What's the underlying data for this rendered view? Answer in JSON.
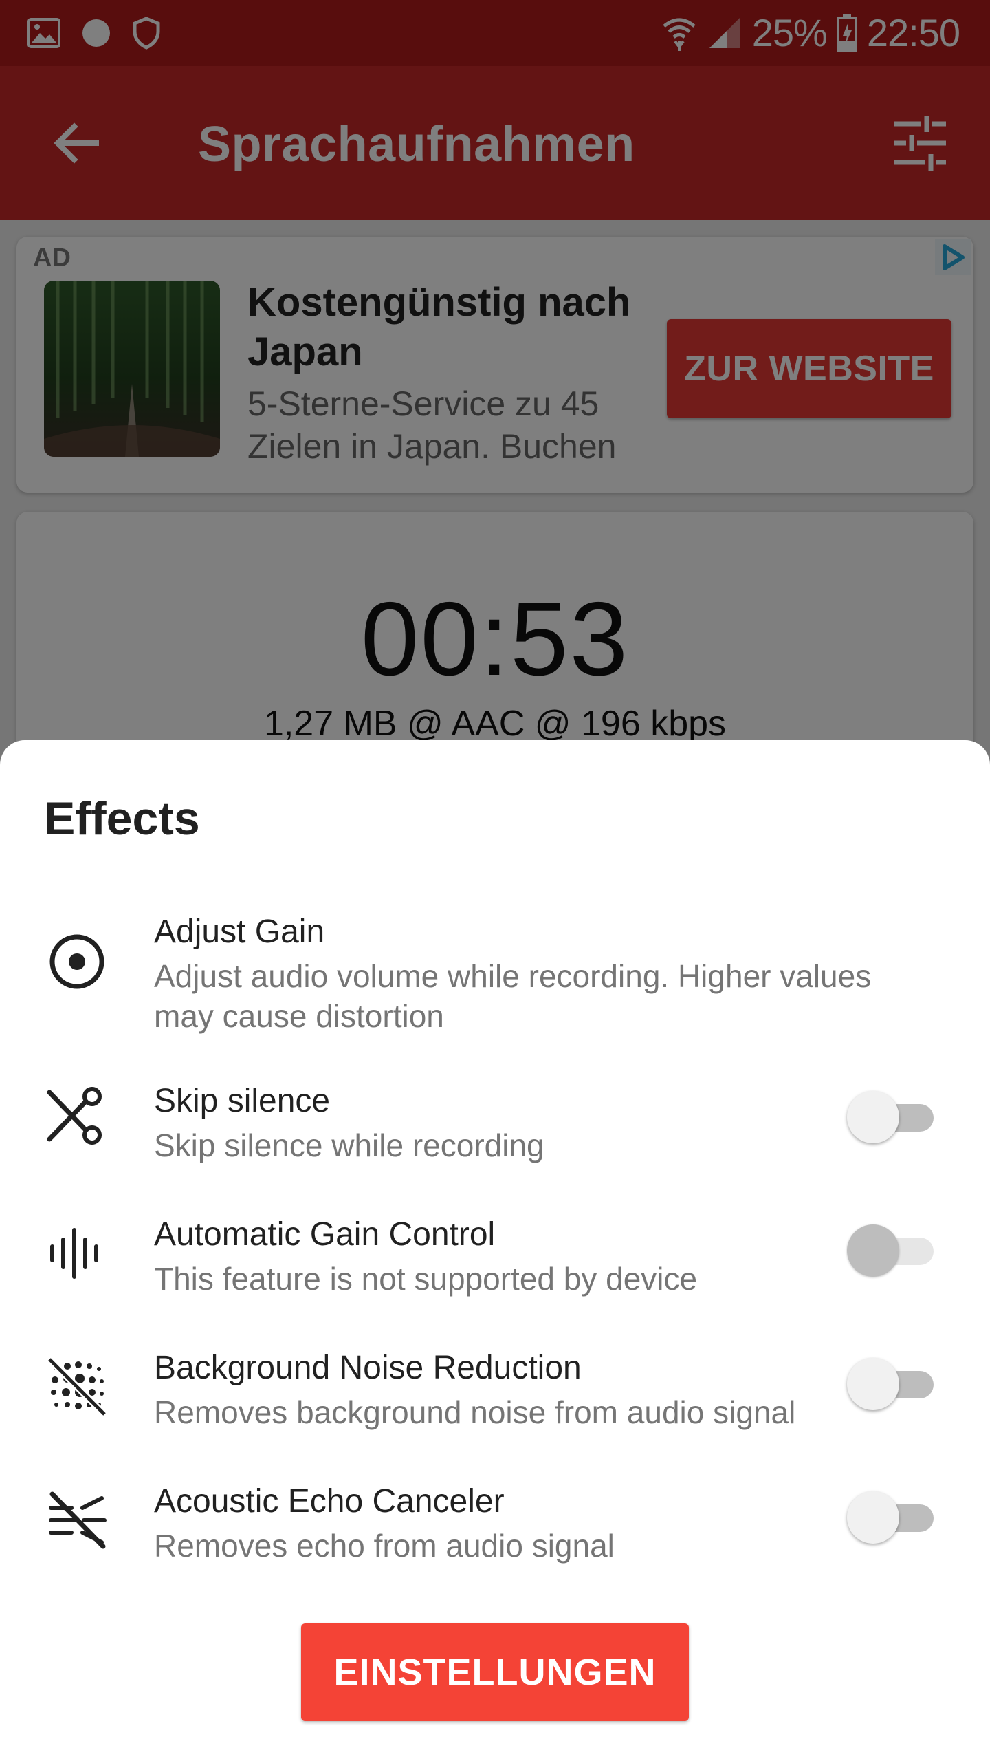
{
  "status_bar": {
    "battery": "25%",
    "time": "22:50",
    "icons": [
      "image-icon",
      "dot-icon",
      "shield-icon",
      "wifi-icon",
      "signal-icon",
      "battery-charging-icon"
    ]
  },
  "app_bar": {
    "title": "Sprachaufnahmen",
    "back_icon": "arrow-back-icon",
    "tune_icon": "tune-icon"
  },
  "ad": {
    "label": "AD",
    "title": "Kostengünstig nach Japan",
    "description": "5-Sterne-Service zu 45 Zielen in Japan. Buchen",
    "cta": "ZUR WEBSITE"
  },
  "recording": {
    "timer": "00:53",
    "info": "1,27 MB @ AAC @ 196 kbps"
  },
  "effects": {
    "title": "Effects",
    "items": [
      {
        "title": "Adjust Gain",
        "subtitle": "Adjust audio volume while recording. Higher values may cause distortion",
        "icon": "radio-button-icon",
        "has_switch": false
      },
      {
        "title": "Skip silence",
        "subtitle": "Skip silence while recording",
        "icon": "scissors-icon",
        "switch_on": false,
        "enabled": true
      },
      {
        "title": "Automatic Gain Control",
        "subtitle": "This feature is not supported by device",
        "icon": "graphic-eq-icon",
        "switch_on": false,
        "enabled": false
      },
      {
        "title": "Background Noise Reduction",
        "subtitle": "Removes background noise from audio signal",
        "icon": "blur-off-icon",
        "switch_on": false,
        "enabled": true
      },
      {
        "title": "Acoustic Echo Canceler",
        "subtitle": "Removes echo from audio signal",
        "icon": "echo-off-icon",
        "switch_on": false,
        "enabled": true
      }
    ],
    "settings_button": "EINSTELLUNGEN"
  },
  "colors": {
    "primary": "#c62828",
    "status_bar": "#b01b1a",
    "accent": "#f44336"
  }
}
